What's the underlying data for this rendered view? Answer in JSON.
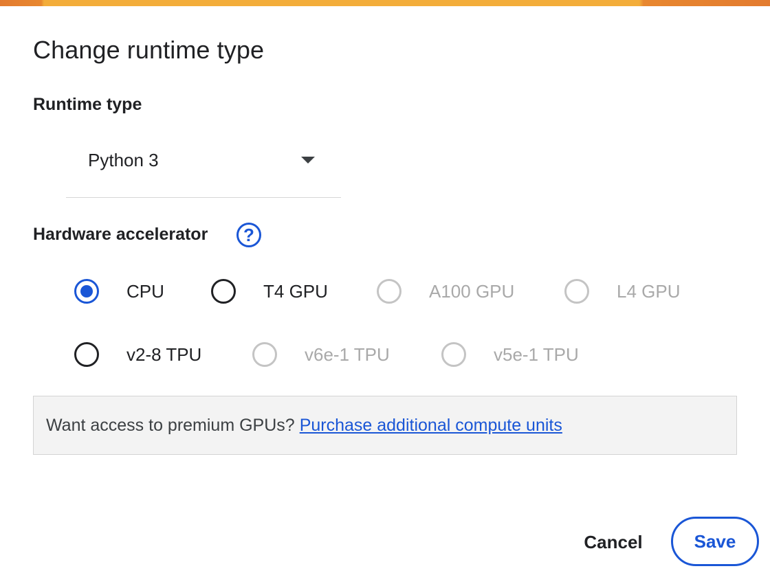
{
  "dialog": {
    "title": "Change runtime type",
    "accent_color": "#1a56d6"
  },
  "runtime": {
    "label": "Runtime type",
    "selected": "Python 3"
  },
  "hardware": {
    "label": "Hardware accelerator",
    "help_icon": "question-mark-circle-icon",
    "options": [
      {
        "label": "CPU",
        "selected": true,
        "disabled": false
      },
      {
        "label": "T4 GPU",
        "selected": false,
        "disabled": false
      },
      {
        "label": "A100 GPU",
        "selected": false,
        "disabled": true
      },
      {
        "label": "L4 GPU",
        "selected": false,
        "disabled": true
      },
      {
        "label": "v2-8 TPU",
        "selected": false,
        "disabled": false
      },
      {
        "label": "v6e-1 TPU",
        "selected": false,
        "disabled": true
      },
      {
        "label": "v5e-1 TPU",
        "selected": false,
        "disabled": true
      }
    ]
  },
  "promo": {
    "text": "Want access to premium GPUs?",
    "link": "Purchase additional compute units"
  },
  "footer": {
    "cancel_label": "Cancel",
    "save_label": "Save"
  }
}
